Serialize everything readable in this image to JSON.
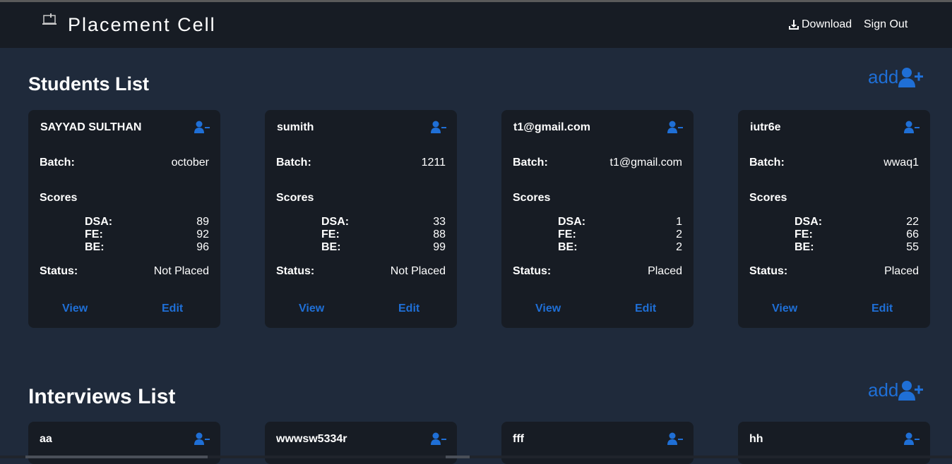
{
  "header": {
    "title": "Placement Cell",
    "download_label": "Download",
    "signout_label": "Sign Out"
  },
  "students": {
    "title": "Students List",
    "add_label": "add",
    "batch_label": "Batch:",
    "scores_label": "Scores",
    "dsa_label": "DSA:",
    "fe_label": "FE:",
    "be_label": "BE:",
    "status_label": "Status:",
    "view_label": "View",
    "edit_label": "Edit",
    "items": [
      {
        "name": "SAYYAD SULTHAN",
        "batch": "october",
        "dsa": "89",
        "fe": "92",
        "be": "96",
        "status": "Not Placed"
      },
      {
        "name": "sumith",
        "batch": "1211",
        "dsa": "33",
        "fe": "88",
        "be": "99",
        "status": "Not Placed"
      },
      {
        "name": "t1@gmail.com",
        "batch": "t1@gmail.com",
        "dsa": "1",
        "fe": "2",
        "be": "2",
        "status": "Placed"
      },
      {
        "name": "iutr6e",
        "batch": "wwaq1",
        "dsa": "22",
        "fe": "66",
        "be": "55",
        "status": "Placed"
      }
    ]
  },
  "interviews": {
    "title": "Interviews List",
    "add_label": "add",
    "items": [
      {
        "name": "aa"
      },
      {
        "name": "wwwsw5334r"
      },
      {
        "name": "fff"
      },
      {
        "name": "hh"
      }
    ]
  },
  "colors": {
    "background": "#1f2a3b",
    "navbar": "#171c24",
    "card": "#171c24",
    "accent": "#1f6fd6"
  }
}
